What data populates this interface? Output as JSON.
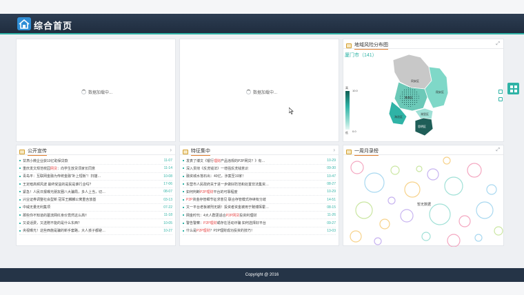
{
  "header": {
    "title": "综合首页"
  },
  "loading_panels": [
    {
      "text": "数据加载中..."
    },
    {
      "text": "数据加载中..."
    }
  ],
  "map_panel": {
    "title": "地域风险分布图",
    "city": "厦门市（141）",
    "legend_max": "10.0",
    "legend_min": "0.0",
    "legend_top_label": "高",
    "legend_bottom_label": "低",
    "districts": [
      "翔安区",
      "同安区",
      "集美区",
      "湖里区",
      "思明区",
      "海沧区"
    ]
  },
  "notice_panel": {
    "title": "公开宣传",
    "items": [
      {
        "pre": "甘肃小微企业获10亿助保贷款",
        "hl": "",
        "post": "",
        "date": "11-07"
      },
      {
        "pre": "重庆发文规范校园",
        "hl": "网贷",
        "post": "：向学生放贷须家长同意",
        "date": "11-14"
      },
      {
        "pre": "青岛平：互联网金融为传统金融“补上短板”！扫描…",
        "hl": "",
        "post": "",
        "date": "10-08"
      },
      {
        "pre": "王定暗高频风波 最终受益的是民是谁行业吗?",
        "hl": "",
        "post": "",
        "date": "17-06"
      },
      {
        "pre": "紧急！人民日报曝光朋友圈八大骗局，多人上当，切…",
        "hl": "",
        "post": "",
        "date": "08-07"
      },
      {
        "pre": "兴业证券调整社会型新 冠军王麟麟公寓重含放基",
        "hl": "",
        "post": "",
        "date": "03-13"
      },
      {
        "pre": "中威无量无利集项",
        "hl": "",
        "post": "",
        "date": "07-22"
      },
      {
        "pre": "那些你不知道的墓流网红身价竟然这么高!!",
        "hl": "",
        "post": "",
        "date": "11-18"
      },
      {
        "pre": "又说话费，又送赠不能的是什么东西？",
        "hl": "",
        "post": "",
        "date": "10-05"
      },
      {
        "pre": "央视曝光！这些西施是骗的新手套路，大人孩子都避…",
        "hl": "",
        "post": "",
        "date": "10-27"
      }
    ]
  },
  "focus_panel": {
    "title": "特征集中",
    "items": [
      {
        "pre": "发表了博文《银行",
        "hl": "理财",
        "post": "产品违规的P2P网贷？》有…",
        "date": "10-29"
      },
      {
        "pre": "深入贯彻《反洗钱法》一增强反洗钱意识",
        "hl": "",
        "post": "",
        "date": "09-30"
      },
      {
        "pre": "融资城水落石出：40亿，涉案至19家！",
        "hl": "",
        "post": "",
        "date": "10-47"
      },
      {
        "pre": "东营市人民政府关于进一步做好防范和处置非法集资…",
        "hl": "",
        "post": "",
        "date": "08-27"
      },
      {
        "pre": "如何判断",
        "hl": "P2P理财",
        "post": "平台的可靠程度",
        "date": "10-29"
      },
      {
        "pre": "",
        "hl": "P2P",
        "post": "资金存管细节征求意见 联合存管模式存续有分歧",
        "date": "14-51"
      },
      {
        "pre": "又一平台老板被刑无期！投资者资金被用于赌博挥霍…",
        "hl": "",
        "post": "",
        "date": "08-15"
      },
      {
        "pre": "网金时代：4大人群更适合",
        "hl": "P2P网贷",
        "post": "投资利理财",
        "date": "11-26"
      },
      {
        "pre": "警告警察：",
        "hl": "P2P理财",
        "post": "或存在活动诈骗 如何选择好平台",
        "date": "09-27"
      },
      {
        "pre": "什么是",
        "hl": "P2P理财",
        "post": "？P2P理财成功投资的技巧！",
        "date": "13-03"
      }
    ]
  },
  "recent_panel": {
    "title": "一周月录榜",
    "center_text": "暂无数据"
  },
  "footer": {
    "copyright": "Copyright @ 2016"
  },
  "colors": {
    "accent": "#2fb3a6",
    "header": "#253447",
    "highlight": "#e64545"
  }
}
